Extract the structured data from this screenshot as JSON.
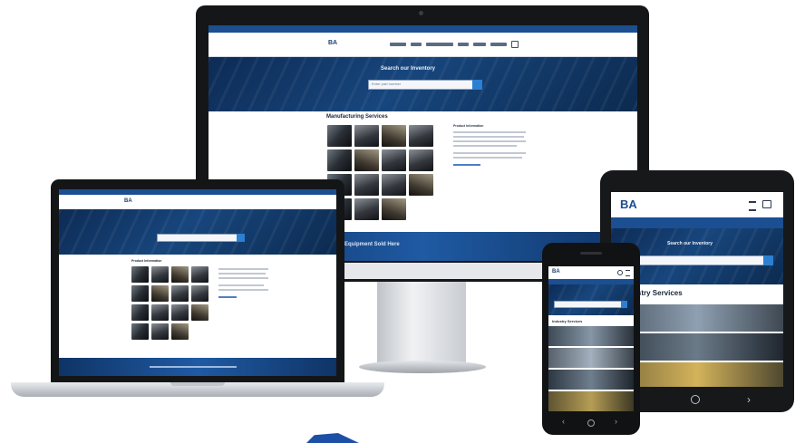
{
  "desktop": {
    "hero_title": "Search our Inventory",
    "search_placeholder": "Enter part number",
    "section_title": "Manufacturing Services",
    "footer_text": "Equipment Sold Here",
    "info_title": "Product Information"
  },
  "laptop": {
    "logo": "BA",
    "section_title": "Product Information"
  },
  "tablet": {
    "logo": "BA",
    "hero_title": "Search our Inventory",
    "section_title": "Industry Services"
  },
  "phone": {
    "logo": "BA",
    "hero_title": "Search our Inventory",
    "section_title": "Industry Services"
  },
  "colors": {
    "brand_blue": "#1b4f92",
    "accent": "#2d7fd1"
  }
}
